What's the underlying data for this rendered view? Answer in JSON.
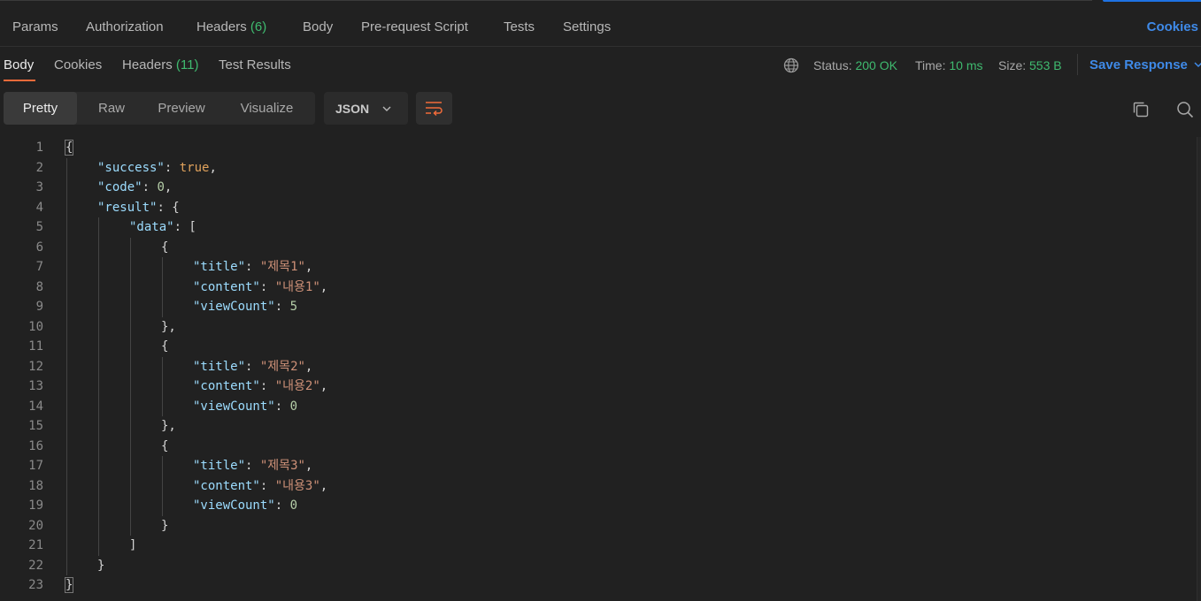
{
  "request_tabs": {
    "params": "Params",
    "authorization": "Authorization",
    "headers_label": "Headers",
    "headers_count": "(6)",
    "body": "Body",
    "prerequest": "Pre-request Script",
    "tests": "Tests",
    "settings": "Settings",
    "cookies": "Cookies"
  },
  "response_tabs": {
    "body": "Body",
    "cookies": "Cookies",
    "headers_label": "Headers",
    "headers_count": "(11)",
    "test_results": "Test Results"
  },
  "status_bar": {
    "status_label": "Status:",
    "status_value": "200 OK",
    "time_label": "Time:",
    "time_value": "10 ms",
    "size_label": "Size:",
    "size_value": "553 B",
    "save_response": "Save Response"
  },
  "view_modes": [
    "Pretty",
    "Raw",
    "Preview",
    "Visualize"
  ],
  "active_view": "Pretty",
  "format": "JSON",
  "colors": {
    "accent": "#f26b3a",
    "link": "#3f8ae8",
    "success": "#3fba6f"
  },
  "icons": [
    "globe-icon",
    "chevron-down-icon",
    "wrap-lines-icon",
    "copy-icon",
    "search-icon"
  ],
  "editor_lines": [
    {
      "num": "1",
      "indent": 0,
      "tokens": [
        [
          "p",
          "{"
        ]
      ]
    },
    {
      "num": "2",
      "indent": 1,
      "tokens": [
        [
          "k",
          "\"success\""
        ],
        [
          "p",
          ": "
        ],
        [
          "b",
          "true"
        ],
        [
          "p",
          ","
        ]
      ]
    },
    {
      "num": "3",
      "indent": 1,
      "tokens": [
        [
          "k",
          "\"code\""
        ],
        [
          "p",
          ": "
        ],
        [
          "n",
          "0"
        ],
        [
          "p",
          ","
        ]
      ]
    },
    {
      "num": "4",
      "indent": 1,
      "tokens": [
        [
          "k",
          "\"result\""
        ],
        [
          "p",
          ": {"
        ]
      ]
    },
    {
      "num": "5",
      "indent": 2,
      "tokens": [
        [
          "k",
          "\"data\""
        ],
        [
          "p",
          ": ["
        ]
      ]
    },
    {
      "num": "6",
      "indent": 3,
      "tokens": [
        [
          "p",
          "{"
        ]
      ]
    },
    {
      "num": "7",
      "indent": 4,
      "tokens": [
        [
          "k",
          "\"title\""
        ],
        [
          "p",
          ": "
        ],
        [
          "s",
          "\"제목1\""
        ],
        [
          "p",
          ","
        ]
      ]
    },
    {
      "num": "8",
      "indent": 4,
      "tokens": [
        [
          "k",
          "\"content\""
        ],
        [
          "p",
          ": "
        ],
        [
          "s",
          "\"내용1\""
        ],
        [
          "p",
          ","
        ]
      ]
    },
    {
      "num": "9",
      "indent": 4,
      "tokens": [
        [
          "k",
          "\"viewCount\""
        ],
        [
          "p",
          ": "
        ],
        [
          "n",
          "5"
        ]
      ]
    },
    {
      "num": "10",
      "indent": 3,
      "tokens": [
        [
          "p",
          "},"
        ]
      ]
    },
    {
      "num": "11",
      "indent": 3,
      "tokens": [
        [
          "p",
          "{"
        ]
      ]
    },
    {
      "num": "12",
      "indent": 4,
      "tokens": [
        [
          "k",
          "\"title\""
        ],
        [
          "p",
          ": "
        ],
        [
          "s",
          "\"제목2\""
        ],
        [
          "p",
          ","
        ]
      ]
    },
    {
      "num": "13",
      "indent": 4,
      "tokens": [
        [
          "k",
          "\"content\""
        ],
        [
          "p",
          ": "
        ],
        [
          "s",
          "\"내용2\""
        ],
        [
          "p",
          ","
        ]
      ]
    },
    {
      "num": "14",
      "indent": 4,
      "tokens": [
        [
          "k",
          "\"viewCount\""
        ],
        [
          "p",
          ": "
        ],
        [
          "n",
          "0"
        ]
      ]
    },
    {
      "num": "15",
      "indent": 3,
      "tokens": [
        [
          "p",
          "},"
        ]
      ]
    },
    {
      "num": "16",
      "indent": 3,
      "tokens": [
        [
          "p",
          "{"
        ]
      ]
    },
    {
      "num": "17",
      "indent": 4,
      "tokens": [
        [
          "k",
          "\"title\""
        ],
        [
          "p",
          ": "
        ],
        [
          "s",
          "\"제목3\""
        ],
        [
          "p",
          ","
        ]
      ]
    },
    {
      "num": "18",
      "indent": 4,
      "tokens": [
        [
          "k",
          "\"content\""
        ],
        [
          "p",
          ": "
        ],
        [
          "s",
          "\"내용3\""
        ],
        [
          "p",
          ","
        ]
      ]
    },
    {
      "num": "19",
      "indent": 4,
      "tokens": [
        [
          "k",
          "\"viewCount\""
        ],
        [
          "p",
          ": "
        ],
        [
          "n",
          "0"
        ]
      ]
    },
    {
      "num": "20",
      "indent": 3,
      "tokens": [
        [
          "p",
          "}"
        ]
      ]
    },
    {
      "num": "21",
      "indent": 2,
      "tokens": [
        [
          "p",
          "]"
        ]
      ]
    },
    {
      "num": "22",
      "indent": 1,
      "tokens": [
        [
          "p",
          "}"
        ]
      ]
    },
    {
      "num": "23",
      "indent": 0,
      "tokens": [
        [
          "p",
          "}"
        ]
      ]
    }
  ]
}
